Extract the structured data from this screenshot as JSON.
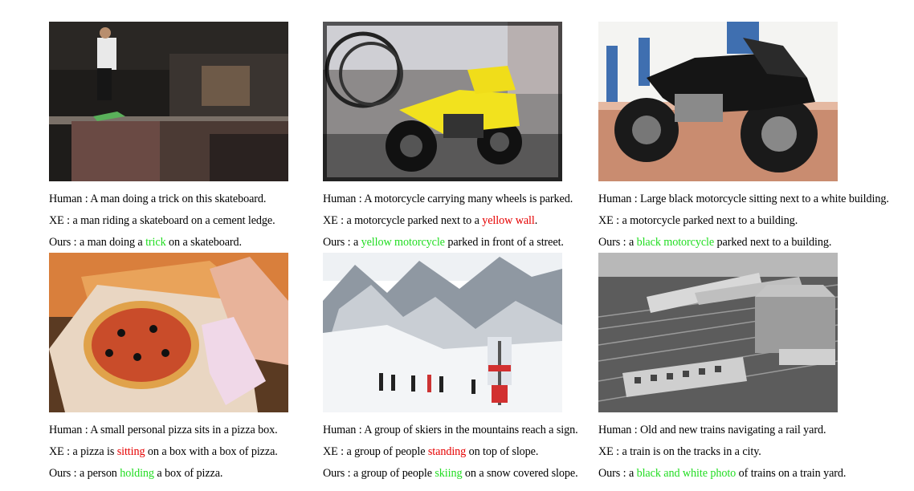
{
  "figures": [
    {
      "image": "skateboarder-grinding-ledge-photo",
      "human": {
        "label": "Human",
        "text": "A man doing a trick on this skateboard."
      },
      "xe": {
        "label": "XE",
        "segments": [
          {
            "t": "a man riding a skateboard on a cement ledge.",
            "c": ""
          }
        ]
      },
      "ours": {
        "label": "Ours",
        "segments": [
          {
            "t": "a man doing a ",
            "c": ""
          },
          {
            "t": "trick",
            "c": "good"
          },
          {
            "t": " on a skateboard.",
            "c": ""
          }
        ]
      }
    },
    {
      "image": "yellow-motorcycle-with-wheels-photo",
      "human": {
        "label": "Human",
        "text": "A motorcycle carrying many wheels is parked."
      },
      "xe": {
        "label": "XE",
        "segments": [
          {
            "t": "a motorcycle parked next to a ",
            "c": ""
          },
          {
            "t": "yellow wall",
            "c": "bad"
          },
          {
            "t": ".",
            "c": ""
          }
        ]
      },
      "ours": {
        "label": "Ours",
        "segments": [
          {
            "t": "a ",
            "c": ""
          },
          {
            "t": "yellow motorcycle",
            "c": "good"
          },
          {
            "t": " parked in front of a street.",
            "c": ""
          }
        ]
      }
    },
    {
      "image": "black-motorcycle-white-building-photo",
      "human": {
        "label": "Human",
        "text": "Large black motorcycle sitting next to a white building."
      },
      "xe": {
        "label": "XE",
        "segments": [
          {
            "t": "a motorcycle parked next to a building.",
            "c": ""
          }
        ]
      },
      "ours": {
        "label": "Ours",
        "segments": [
          {
            "t": "a ",
            "c": ""
          },
          {
            "t": "black motorcycle",
            "c": "good"
          },
          {
            "t": " parked next to a building.",
            "c": ""
          }
        ]
      }
    },
    {
      "image": "pizza-in-box-photo",
      "human": {
        "label": "Human",
        "text": "A small personal pizza sits in a pizza box."
      },
      "xe": {
        "label": "XE",
        "segments": [
          {
            "t": "a pizza is ",
            "c": ""
          },
          {
            "t": "sitting",
            "c": "bad"
          },
          {
            "t": " on a box with a box of pizza.",
            "c": ""
          }
        ]
      },
      "ours": {
        "label": "Ours",
        "segments": [
          {
            "t": "a person ",
            "c": ""
          },
          {
            "t": "holding",
            "c": "good"
          },
          {
            "t": " a box of pizza.",
            "c": ""
          }
        ]
      }
    },
    {
      "image": "skiers-mountain-sign-photo",
      "human": {
        "label": "Human",
        "text": "A group of skiers in the mountains reach a sign."
      },
      "xe": {
        "label": "XE",
        "segments": [
          {
            "t": "a group of people ",
            "c": ""
          },
          {
            "t": "standing",
            "c": "bad"
          },
          {
            "t": " on top of slope.",
            "c": ""
          }
        ]
      },
      "ours": {
        "label": "Ours",
        "segments": [
          {
            "t": "a group of people ",
            "c": ""
          },
          {
            "t": "skiing",
            "c": "good"
          },
          {
            "t": " on a snow covered slope.",
            "c": ""
          }
        ]
      }
    },
    {
      "image": "trains-rail-yard-bw-photo",
      "human": {
        "label": "Human",
        "text": "Old and new trains navigating a rail yard."
      },
      "xe": {
        "label": "XE",
        "segments": [
          {
            "t": "a train is on the tracks in a city.",
            "c": ""
          }
        ]
      },
      "ours": {
        "label": "Ours",
        "segments": [
          {
            "t": "a ",
            "c": ""
          },
          {
            "t": "black and white photo",
            "c": "good"
          },
          {
            "t": " of trains on a train yard.",
            "c": ""
          }
        ]
      }
    }
  ],
  "separator": " : "
}
